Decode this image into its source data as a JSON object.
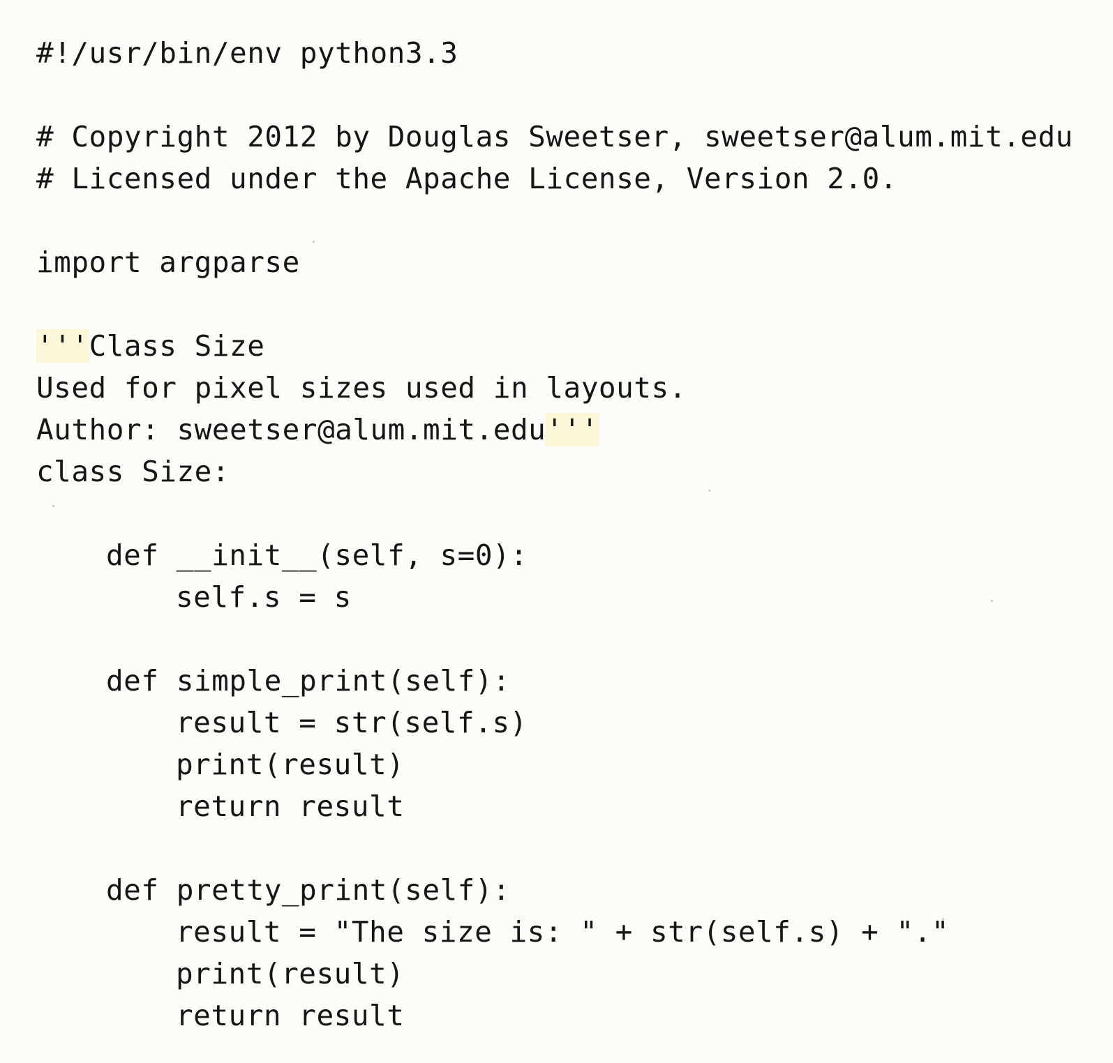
{
  "lines": {
    "shebang": "#!/usr/bin/env python3.3",
    "copyright": "# Copyright 2012 by Douglas Sweetser, sweetser@alum.mit.edu",
    "license": "# Licensed under the Apache License, Version 2.0.",
    "import": "import argparse",
    "doc_open_quote": "'''",
    "doc_title": "Class Size",
    "doc_desc": "Used for pixel sizes used in layouts.",
    "doc_author": "Author: sweetser@alum.mit.edu",
    "doc_close_quote": "'''",
    "class_decl": "class Size:",
    "init_def": "def __init__(self, s=0):",
    "init_body": "self.s = s",
    "simple_def": "def simple_print(self):",
    "simple_result": "result = str(self.s)",
    "simple_print": "print(result)",
    "simple_return": "return result",
    "pretty_def": "def pretty_print(self):",
    "pretty_result": "result = \"The size is: \" + str(self.s) + \".\"",
    "pretty_print": "print(result)",
    "pretty_return": "return result"
  }
}
